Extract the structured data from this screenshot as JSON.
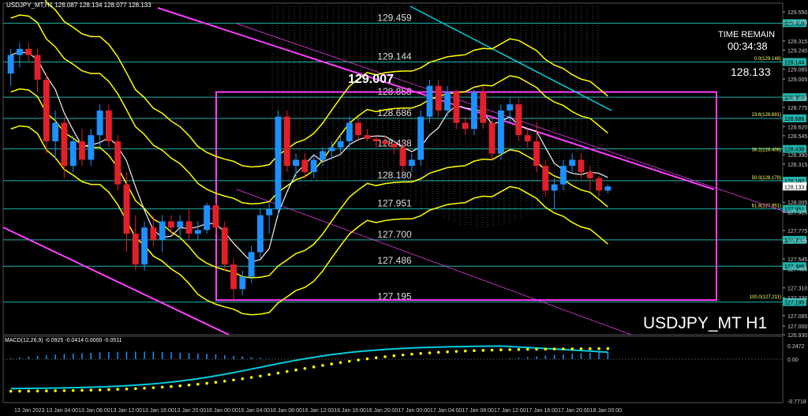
{
  "header": {
    "text": "USDJPY_MT,H1  128.087 128.134 128.077 128.133"
  },
  "time_remain": {
    "label": "TIME REMAIN",
    "value": "00:34:38"
  },
  "current_price": "128.133",
  "symbol_label": "USDJPY_MT H1",
  "macd_label": "MACD(12,26,9) -0.0925 -0.0414 0.0000 -0.0511",
  "colors": {
    "bull": "#1e90ff",
    "bear": "#e0202a",
    "band": "#ffff00",
    "level": "#20b2aa",
    "box": "#ff40ff",
    "ma": "#f4f4f4",
    "macd_line": "#00ccdd"
  },
  "chart_data": [
    {
      "type": "candlestick",
      "title": "USDJPY_MT H1",
      "ylim": [
        126.93,
        129.57
      ],
      "x_ticks": [
        "13 Jan 2023",
        "13 Jan 04:00",
        "13 Jan 08:00",
        "13 Jan 12:00",
        "13 Jan 16:00",
        "13 Jan 20:00",
        "16 Jan 00:00",
        "16 Jan 04:00",
        "16 Jan 08:00",
        "16 Jan 12:00",
        "16 Jan 16:00",
        "16 Jan 20:00",
        "17 Jan 00:00",
        "17 Jan 04:00",
        "17 Jan 08:00",
        "17 Jan 12:00",
        "17 Jan 16:00",
        "17 Jan 20:00",
        "18 Jan 00:00"
      ],
      "y_ticks": [
        "129.550",
        "129.315",
        "129.085",
        "128.850",
        "128.620",
        "128.390",
        "128.160",
        "127.925",
        "127.695",
        "127.465",
        "127.230",
        "127.000",
        "126.930",
        "128.005",
        "128.315",
        "128.545",
        "128.775",
        "129.005",
        "129.240",
        "129.470",
        "127.775",
        "127.545",
        "127.310",
        "127.085"
      ],
      "levels": [
        {
          "price": 129.459,
          "label": "129.459"
        },
        {
          "price": 129.144,
          "label": "129.144"
        },
        {
          "price": 128.858,
          "label": "128.858"
        },
        {
          "price": 128.686,
          "label": "128.686"
        },
        {
          "price": 128.438,
          "label": "128.438"
        },
        {
          "price": 128.18,
          "label": "128.180"
        },
        {
          "price": 127.951,
          "label": "127.951"
        },
        {
          "price": 127.7,
          "label": "127.700"
        },
        {
          "price": 127.486,
          "label": "127.486"
        },
        {
          "price": 127.195,
          "label": "127.195"
        }
      ],
      "fibo": [
        {
          "price": 129.148,
          "label": "0.0(129.148)"
        },
        {
          "price": 128.691,
          "label": "23.6(128.691)"
        },
        {
          "price": 128.406,
          "label": "38.2(128.406)"
        },
        {
          "price": 128.179,
          "label": "50.0(128.179)"
        },
        {
          "price": 127.951,
          "label": "61.8(127.951)"
        },
        {
          "price": 127.211,
          "label": "100.0(127.211)"
        }
      ],
      "high_annotation": {
        "price": 129.007,
        "label": "129.007"
      },
      "candles": [
        [
          129.05,
          129.25,
          128.95,
          129.2
        ],
        [
          129.2,
          129.3,
          129.1,
          129.25
        ],
        [
          129.25,
          129.3,
          129.15,
          129.2
        ],
        [
          129.2,
          129.25,
          128.9,
          129.0
        ],
        [
          129.0,
          129.05,
          128.4,
          128.5
        ],
        [
          128.5,
          128.75,
          128.35,
          128.65
        ],
        [
          128.65,
          128.7,
          128.2,
          128.3
        ],
        [
          128.3,
          128.55,
          128.25,
          128.5
        ],
        [
          128.5,
          128.6,
          128.3,
          128.35
        ],
        [
          128.35,
          128.6,
          128.3,
          128.55
        ],
        [
          128.55,
          128.8,
          128.45,
          128.75
        ],
        [
          128.75,
          128.8,
          128.45,
          128.5
        ],
        [
          128.5,
          128.55,
          128.1,
          128.15
        ],
        [
          128.15,
          128.25,
          127.6,
          127.75
        ],
        [
          127.75,
          127.9,
          127.45,
          127.5
        ],
        [
          127.5,
          127.85,
          127.45,
          127.8
        ],
        [
          127.8,
          127.9,
          127.65,
          127.7
        ],
        [
          127.7,
          127.9,
          127.6,
          127.85
        ],
        [
          127.85,
          127.9,
          127.75,
          127.8
        ],
        [
          127.8,
          127.9,
          127.7,
          127.85
        ],
        [
          127.85,
          127.95,
          127.7,
          127.75
        ],
        [
          127.75,
          127.85,
          127.7,
          127.78
        ],
        [
          127.78,
          128.0,
          127.75,
          127.98
        ],
        [
          127.98,
          128.0,
          127.75,
          127.8
        ],
        [
          127.8,
          127.85,
          127.45,
          127.5
        ],
        [
          127.5,
          127.55,
          127.2,
          127.3
        ],
        [
          127.3,
          127.45,
          127.25,
          127.4
        ],
        [
          127.4,
          127.65,
          127.35,
          127.6
        ],
        [
          127.6,
          127.95,
          127.55,
          127.9
        ],
        [
          127.9,
          128.0,
          127.75,
          127.95
        ],
        [
          127.95,
          128.75,
          127.9,
          128.7
        ],
        [
          128.7,
          128.75,
          128.25,
          128.3
        ],
        [
          128.3,
          128.4,
          128.2,
          128.35
        ],
        [
          128.35,
          128.4,
          128.2,
          128.25
        ],
        [
          128.25,
          128.4,
          128.2,
          128.35
        ],
        [
          128.35,
          128.45,
          128.3,
          128.42
        ],
        [
          128.42,
          128.5,
          128.35,
          128.45
        ],
        [
          128.45,
          128.55,
          128.4,
          128.5
        ],
        [
          128.5,
          128.7,
          128.45,
          128.65
        ],
        [
          128.65,
          128.7,
          128.5,
          128.55
        ],
        [
          128.55,
          128.6,
          128.5,
          128.52
        ],
        [
          128.52,
          128.55,
          128.45,
          128.5
        ],
        [
          128.5,
          128.55,
          128.45,
          128.48
        ],
        [
          128.48,
          128.5,
          128.4,
          128.45
        ],
        [
          128.45,
          128.5,
          128.25,
          128.3
        ],
        [
          128.3,
          128.4,
          128.25,
          128.35
        ],
        [
          128.35,
          128.75,
          128.3,
          128.7
        ],
        [
          128.7,
          129.0,
          128.65,
          128.95
        ],
        [
          128.95,
          129.0,
          128.7,
          128.75
        ],
        [
          128.75,
          128.95,
          128.7,
          128.9
        ],
        [
          128.9,
          128.92,
          128.6,
          128.65
        ],
        [
          128.65,
          128.7,
          128.55,
          128.6
        ],
        [
          128.6,
          128.92,
          128.55,
          128.9
        ],
        [
          128.9,
          128.95,
          128.6,
          128.65
        ],
        [
          128.65,
          128.7,
          128.35,
          128.4
        ],
        [
          128.4,
          128.8,
          128.35,
          128.75
        ],
        [
          128.75,
          128.85,
          128.65,
          128.8
        ],
        [
          128.8,
          128.85,
          128.5,
          128.55
        ],
        [
          128.55,
          128.6,
          128.45,
          128.5
        ],
        [
          128.5,
          128.65,
          128.25,
          128.3
        ],
        [
          128.3,
          128.35,
          128.05,
          128.1
        ],
        [
          128.1,
          128.2,
          127.95,
          128.15
        ],
        [
          128.15,
          128.35,
          128.1,
          128.3
        ],
        [
          128.3,
          128.4,
          128.25,
          128.35
        ],
        [
          128.35,
          128.4,
          128.2,
          128.25
        ],
        [
          128.25,
          128.3,
          128.1,
          128.2
        ],
        [
          128.2,
          128.22,
          128.05,
          128.1
        ],
        [
          128.1,
          128.15,
          128.077,
          128.133
        ]
      ],
      "macd": {
        "label": "MACD(12,26,9)",
        "ylim": [
          -0.7718,
          0.2472
        ],
        "y_ticks": [
          "0.2472",
          "0.00",
          "-0.7718"
        ]
      }
    }
  ]
}
